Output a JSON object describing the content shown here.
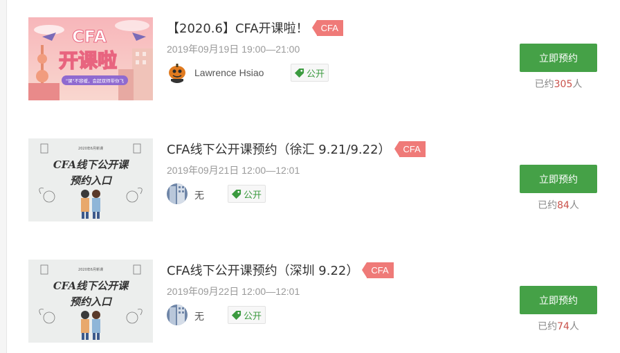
{
  "courses": [
    {
      "title": "【2020.6】CFA开课啦！",
      "tag": "CFA",
      "time": "2019年09月19日 19:00—21:00",
      "teacher": "Lawrence Hsiao",
      "visibility": "公开",
      "button": "立即预约",
      "booked_prefix": "已约",
      "booked_count": "305",
      "booked_suffix": "人",
      "thumb_text_main": "开课啦",
      "thumb_text_top": "CFA",
      "thumb_text_sub": "\"课\"不容缓，会超双师带你飞",
      "avatar": "pumpkin-avatar"
    },
    {
      "title": "CFA线下公开课预约（徐汇 9.21/9.22）",
      "tag": "CFA",
      "time": "2019年09月21日 12:00—12:01",
      "teacher": "无",
      "visibility": "公开",
      "button": "立即预约",
      "booked_prefix": "已约",
      "booked_count": "84",
      "booked_suffix": "人",
      "thumb_text_small": "2020年6月新课",
      "thumb_text_line1": "CFA线下公开课",
      "thumb_text_line2": "预约入口",
      "avatar": "building-avatar"
    },
    {
      "title": "CFA线下公开课预约（深圳 9.22）",
      "tag": "CFA",
      "time": "2019年09月22日 12:00—12:01",
      "teacher": "无",
      "visibility": "公开",
      "button": "立即预约",
      "booked_prefix": "已约",
      "booked_count": "74",
      "booked_suffix": "人",
      "thumb_text_small": "2020年6月新课",
      "thumb_text_line1": "CFA线下公开课",
      "thumb_text_line2": "预约入口",
      "avatar": "building-avatar"
    }
  ],
  "colors": {
    "accent_green": "#45a147",
    "tag_red": "#ef7a78",
    "count_red": "#c9514a",
    "public_green": "#3b9a3f"
  }
}
